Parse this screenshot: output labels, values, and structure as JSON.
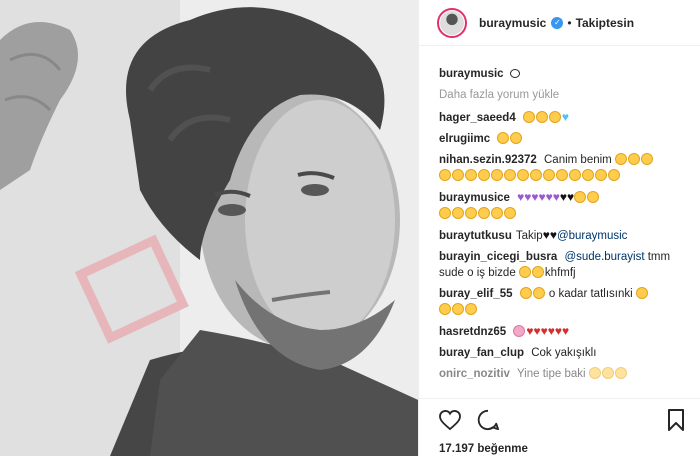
{
  "post": {
    "username": "buraymusic",
    "follow_label": "Takiptesin",
    "dot": "•"
  },
  "caption": {
    "username": "buraymusic"
  },
  "load_more": "Daha fazla yorum yükle",
  "comments": [
    {
      "user": "hager_saeed4",
      "text": ""
    },
    {
      "user": "elrugiimc",
      "text": ""
    },
    {
      "user": "nihan.sezin.92372",
      "text": "Canim benim"
    },
    {
      "user": "buraymusice",
      "text": ""
    },
    {
      "user": "buraytutkusu",
      "text": "Takip",
      "mention": "@buraymusic"
    },
    {
      "user": "burayin_cicegi_busra",
      "mention": "@sude.burayist",
      "text": "tmm",
      "text2": "sude o iş bizde",
      "text3": "khfmfj"
    },
    {
      "user": "buray_elif_55",
      "text": "o kadar tatlısınki"
    },
    {
      "user": "hasretdnz65",
      "text": ""
    },
    {
      "user": "buray_fan_clup",
      "text": "Cok yakışıklı"
    },
    {
      "user": "onirc_nozitiv",
      "text": "Yine tipe baki"
    }
  ],
  "likes": "17.197 beğenme",
  "icons": [
    "heart-icon",
    "comment-icon",
    "bookmark-icon",
    "verified-icon",
    "speech-bubble-icon"
  ],
  "colors": {
    "verified": "#3897f0",
    "text": "#262626",
    "muted": "#999999",
    "emoji": "#ffcc4d"
  }
}
